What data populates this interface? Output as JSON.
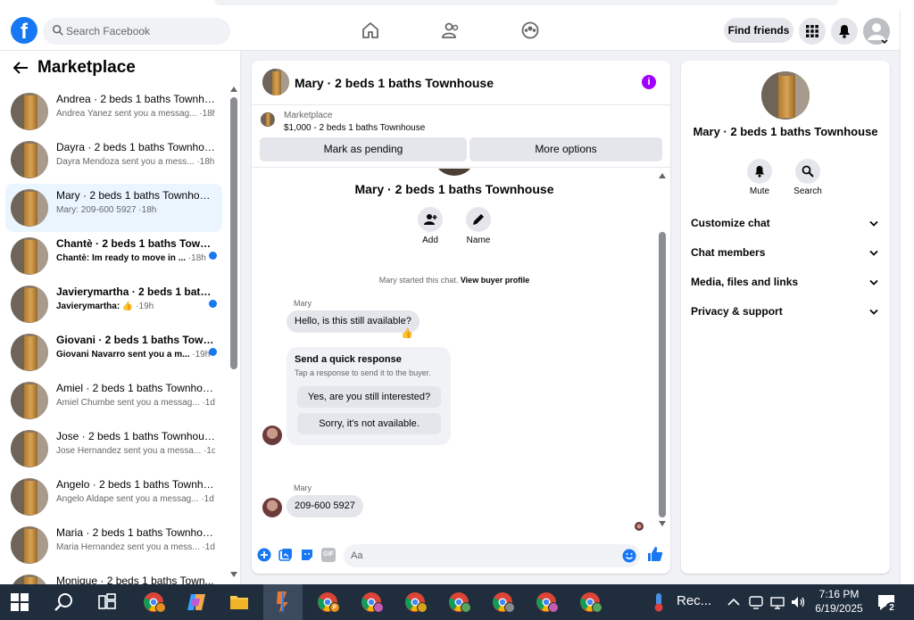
{
  "topbar": {
    "logo_letter": "f",
    "search_placeholder": "Search Facebook",
    "find_friends": "Find friends"
  },
  "sidebar": {
    "title": "Marketplace",
    "conversations": [
      {
        "name": "Andrea · 2 beds 1 baths Townho...",
        "preview": "Andrea Yanez sent you a messag...",
        "time": "·18h",
        "unread": false,
        "active": false
      },
      {
        "name": "Dayra · 2 beds 1 baths Townhou...",
        "preview": "Dayra Mendoza sent you a mess...",
        "time": "·18h",
        "unread": false,
        "active": false
      },
      {
        "name": "Mary · 2 beds 1 baths Townhouse",
        "preview": "Mary: 209-600 5927",
        "time": "·18h",
        "unread": false,
        "active": true
      },
      {
        "name": "Chantè · 2 beds 1 baths Town...",
        "preview": "Chantè: Im ready to move in ...",
        "time": "·18h",
        "unread": true,
        "active": false
      },
      {
        "name": "Javierymartha · 2 beds 1 bath...",
        "preview": "Javierymartha: 👍",
        "time": "·19h",
        "unread": true,
        "active": false
      },
      {
        "name": "Giovani · 2 beds 1 baths Town...",
        "preview": "Giovani Navarro sent you a m...",
        "time": "·19h",
        "unread": true,
        "active": false
      },
      {
        "name": "Amiel · 2 beds 1 baths Townhou...",
        "preview": "Amiel Chumbe sent you a messag...",
        "time": "·1d",
        "unread": false,
        "active": false
      },
      {
        "name": "Jose · 2 beds 1 baths Townhouse",
        "preview": "Jose Hernandez sent you a messa...",
        "time": "·1d",
        "unread": false,
        "active": false
      },
      {
        "name": "Angelo · 2 beds 1 baths Townho...",
        "preview": "Angelo Aldape sent you a messag...",
        "time": "·1d",
        "unread": false,
        "active": false
      },
      {
        "name": "Maria · 2 beds 1 baths Townhou...",
        "preview": "Maria Hernandez sent you a mess...",
        "time": "·1d",
        "unread": false,
        "active": false
      },
      {
        "name": "Monique · 2 beds 1 baths Town...",
        "preview": "",
        "time": "",
        "unread": false,
        "active": false
      }
    ]
  },
  "chat": {
    "header_title": "Mary · 2 beds 1 baths Townhouse",
    "info_glyph": "i",
    "marketplace_label": "Marketplace",
    "listing_price": "$1,000 - 2 beds 1 baths Townhouse",
    "mark_pending": "Mark as pending",
    "more_options": "More options",
    "conversation_title": "Mary · 2 beds 1 baths Townhouse",
    "add_label": "Add",
    "name_label": "Name",
    "system_message": "Mary started this chat.",
    "view_buyer_profile": "View buyer profile",
    "sender_1": "Mary",
    "message_1": "Hello, is this still available?",
    "reaction_1": "👍",
    "quick_title": "Send a quick response",
    "quick_subtitle": "Tap a response to send it to the buyer.",
    "quick_option_1": "Yes, are you still interested?",
    "quick_option_2": "Sorry, it's not available.",
    "sender_2": "Mary",
    "message_2": "209-600 5927",
    "composer_placeholder": "Aa",
    "gif_label": "GIF"
  },
  "details": {
    "title": "Mary · 2 beds 1 baths Townhouse",
    "mute_label": "Mute",
    "search_label": "Search",
    "rows": [
      "Customize chat",
      "Chat members",
      "Media, files and links",
      "Privacy & support"
    ]
  },
  "taskbar": {
    "app_label": "Rec...",
    "time": "7:16 PM",
    "date": "6/19/2025",
    "notification_count": "2",
    "chrome_badge_letter": "F"
  },
  "colors": {
    "brand": "#1877f2",
    "info": "#a100ff",
    "active_row": "#ebf5ff",
    "taskbar": "#1f2d3d"
  }
}
